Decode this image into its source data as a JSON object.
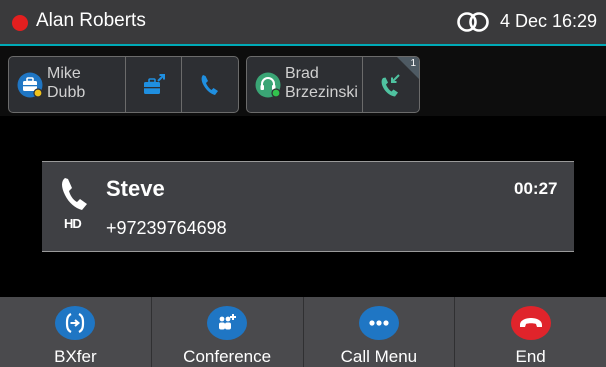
{
  "status": {
    "user_name": "Alan Roberts",
    "datetime": "4 Dec 16:29",
    "presence_color": "#e31f1f"
  },
  "linekeys": {
    "group1": {
      "contact_first": "Mike",
      "contact_last": "Dubb",
      "icons": [
        "briefcase-presence-icon",
        "briefcase-transfer-icon",
        "phone-icon"
      ]
    },
    "group2": {
      "contact_first": "Brad",
      "contact_last": "Brzezinski",
      "badge_count": "1",
      "icons": [
        "headset-presence-icon",
        "incoming-call-icon"
      ]
    }
  },
  "call": {
    "caller_name": "Steve",
    "caller_number": "+97239764698",
    "timer": "00:27",
    "hd_label": "HD"
  },
  "softkeys": [
    {
      "label": "BXfer",
      "icon": "blind-transfer-icon",
      "color": "#1f76c4"
    },
    {
      "label": "Conference",
      "icon": "conference-icon",
      "color": "#1f76c4"
    },
    {
      "label": "Call Menu",
      "icon": "more-icon",
      "color": "#1f76c4"
    },
    {
      "label": "End",
      "icon": "end-call-icon",
      "color": "#e0242b"
    }
  ]
}
